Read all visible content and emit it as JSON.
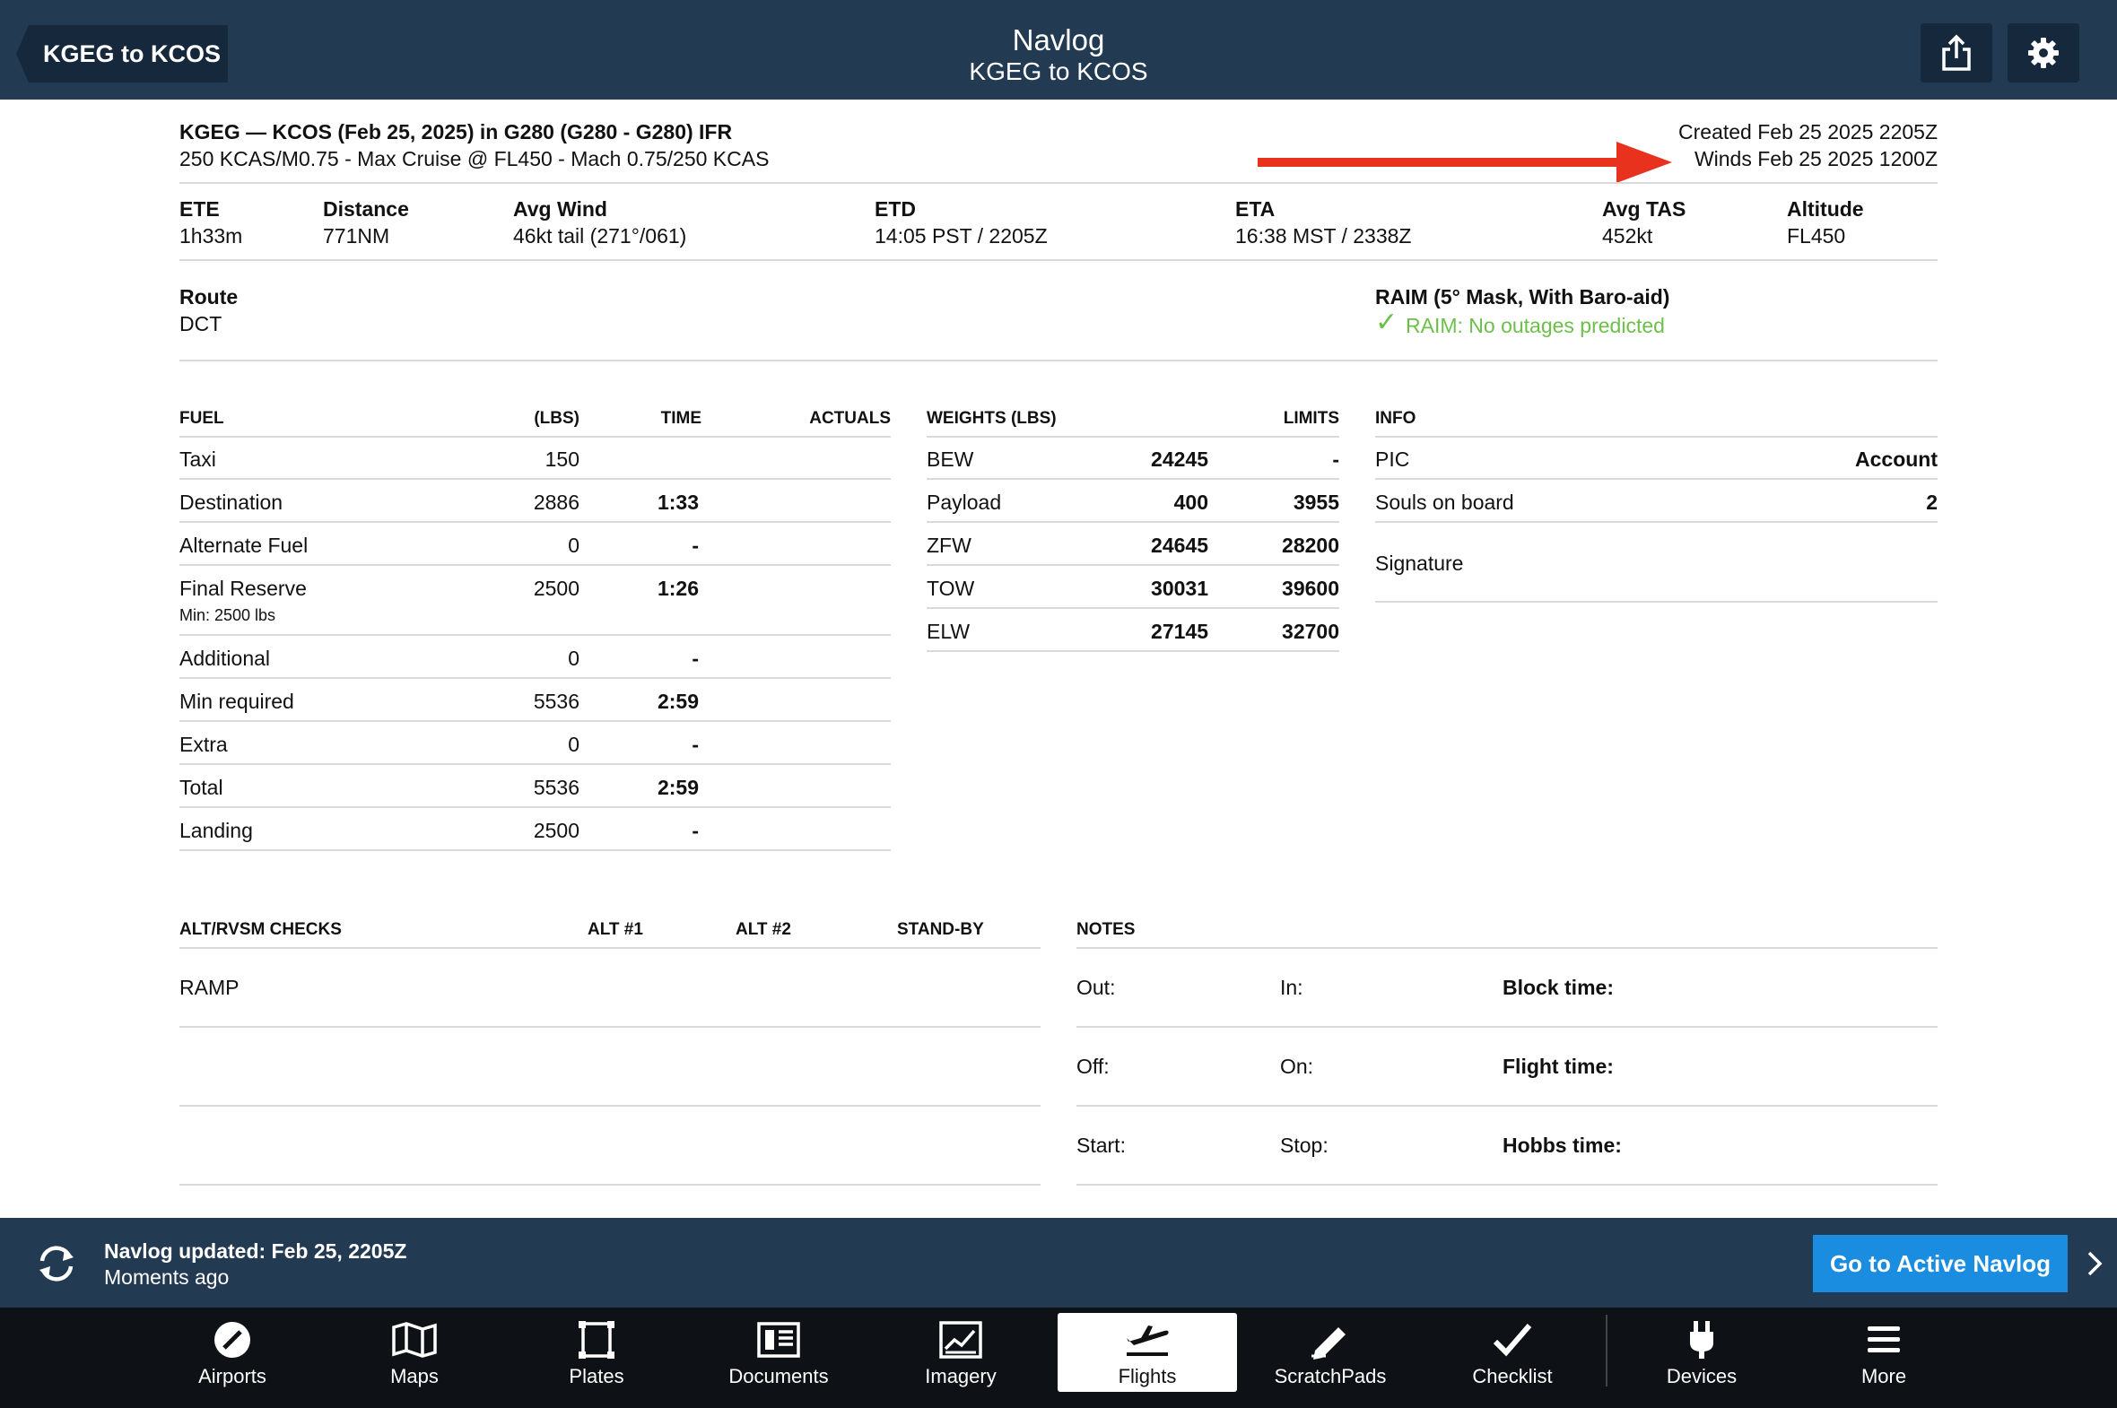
{
  "header": {
    "back_label": "KGEG to KCOS",
    "title": "Navlog",
    "subtitle": "KGEG to KCOS"
  },
  "summary": {
    "flight_line": "KGEG — KCOS (Feb 25, 2025) in G280 (G280 - G280) IFR",
    "profile_line": "250 KCAS/M0.75 - Max Cruise @ FL450 - Mach 0.75/250 KCAS",
    "created": "Created Feb 25 2025 2205Z",
    "winds": "Winds Feb 25 2025 1200Z"
  },
  "stats": [
    {
      "label": "ETE",
      "value": "1h33m"
    },
    {
      "label": "Distance",
      "value": "771NM"
    },
    {
      "label": "Avg Wind",
      "value": "46kt tail (271°/061)"
    },
    {
      "label": "ETD",
      "value": "14:05 PST / 2205Z"
    },
    {
      "label": "ETA",
      "value": "16:38 MST / 2338Z"
    },
    {
      "label": "Avg TAS",
      "value": "452kt"
    },
    {
      "label": "Altitude",
      "value": "FL450"
    }
  ],
  "route": {
    "label": "Route",
    "value": "DCT"
  },
  "raim": {
    "label": "RAIM (5° Mask, With Baro-aid)",
    "check": "✓",
    "status": "RAIM: No outages predicted",
    "status_color": "#6cc04a"
  },
  "fuel": {
    "headers": [
      "FUEL",
      "(LBS)",
      "TIME",
      "ACTUALS"
    ],
    "rows": [
      {
        "name": "Taxi",
        "lbs": "150",
        "time": ""
      },
      {
        "name": "Destination",
        "lbs": "2886",
        "time": "1:33"
      },
      {
        "name": "Alternate Fuel",
        "lbs": "0",
        "time": "-"
      },
      {
        "name": "Final Reserve",
        "lbs": "2500",
        "time": "1:26",
        "note": "Min: 2500 lbs"
      },
      {
        "name": "Additional",
        "lbs": "0",
        "time": "-"
      },
      {
        "name": "Min required",
        "lbs": "5536",
        "time": "2:59"
      },
      {
        "name": "Extra",
        "lbs": "0",
        "time": "-"
      },
      {
        "name": "Total",
        "lbs": "5536",
        "time": "2:59"
      },
      {
        "name": "Landing",
        "lbs": "2500",
        "time": "-"
      }
    ]
  },
  "weights": {
    "headers": [
      "WEIGHTS (LBS)",
      "LIMITS"
    ],
    "rows": [
      {
        "name": "BEW",
        "value": "24245",
        "limit": "-"
      },
      {
        "name": "Payload",
        "value": "400",
        "limit": "3955"
      },
      {
        "name": "ZFW",
        "value": "24645",
        "limit": "28200"
      },
      {
        "name": "TOW",
        "value": "30031",
        "limit": "39600"
      },
      {
        "name": "ELW",
        "value": "27145",
        "limit": "32700"
      }
    ]
  },
  "info": {
    "header": "INFO",
    "pic_label": "PIC",
    "pic_value": "Account",
    "souls_label": "Souls on board",
    "souls_value": "2",
    "signature_label": "Signature"
  },
  "alt_checks": {
    "headers": [
      "ALT/RVSM CHECKS",
      "ALT #1",
      "ALT #2",
      "STAND-BY"
    ],
    "rows": [
      "RAMP",
      "",
      ""
    ]
  },
  "notes": {
    "header": "NOTES",
    "rows": [
      {
        "a": "Out:",
        "b": "In:",
        "c": "Block time:"
      },
      {
        "a": "Off:",
        "b": "On:",
        "c": "Flight time:"
      },
      {
        "a": "Start:",
        "b": "Stop:",
        "c": "Hobbs time:"
      }
    ]
  },
  "banner": {
    "title": "Navlog updated: Feb 25, 2205Z",
    "subtitle": "Moments ago",
    "button": "Go to Active Navlog"
  },
  "tabs": [
    {
      "label": "Airports",
      "icon": "airports-icon"
    },
    {
      "label": "Maps",
      "icon": "maps-icon"
    },
    {
      "label": "Plates",
      "icon": "plates-icon"
    },
    {
      "label": "Documents",
      "icon": "documents-icon"
    },
    {
      "label": "Imagery",
      "icon": "imagery-icon"
    },
    {
      "label": "Flights",
      "icon": "flights-icon",
      "active": true
    },
    {
      "label": "ScratchPads",
      "icon": "scratchpads-icon"
    },
    {
      "label": "Checklist",
      "icon": "checklist-icon"
    },
    {
      "label": "Devices",
      "icon": "devices-icon"
    },
    {
      "label": "More",
      "icon": "more-icon"
    }
  ],
  "colors": {
    "bar": "#233a53",
    "accent": "#1a8de0",
    "arrow": "#e8321e",
    "ok": "#6cc04a"
  }
}
